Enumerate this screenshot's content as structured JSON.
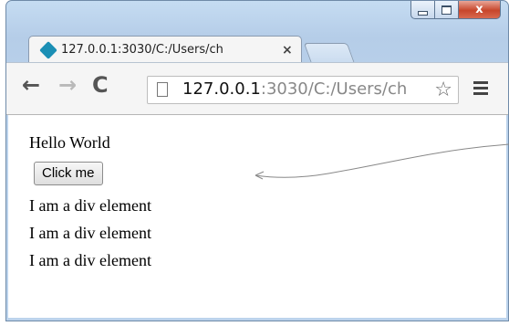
{
  "window": {
    "minimize_label": "",
    "maximize_label": "",
    "close_label": "x"
  },
  "tab": {
    "title": "127.0.0.1:3030/C:/Users/ch",
    "close_glyph": "×",
    "favicon": "site-favicon"
  },
  "toolbar": {
    "back_glyph": "←",
    "forward_glyph": "→",
    "reload_glyph": "C",
    "url_host": "127.0.0.1",
    "url_path": ":3030/C:/Users/ch",
    "star_glyph": "☆"
  },
  "page": {
    "hello_text": "Hello World",
    "button_label": "Click me",
    "div_lines": [
      "I am a div element",
      "I am a div element",
      "I am a div element"
    ]
  },
  "colors": {
    "frame": "#bcd3ec",
    "close_button": "#c7462b",
    "favicon": "#1b8fb5"
  }
}
